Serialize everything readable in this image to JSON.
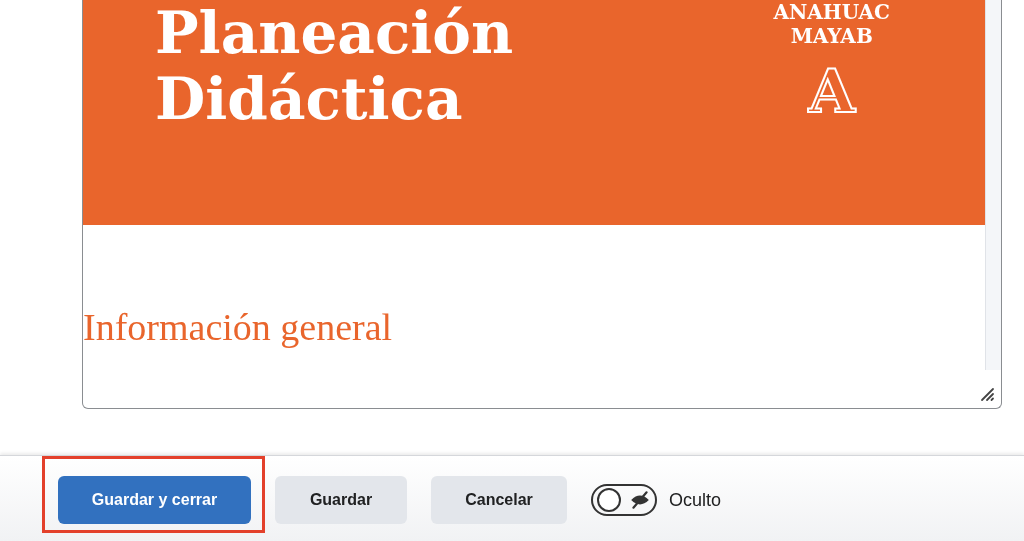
{
  "editor": {
    "banner": {
      "title_lines": [
        "Planeación",
        "Didáctica"
      ],
      "logo_lines": [
        "ANAHUAC",
        "MAYAB"
      ],
      "logo_letter": "A"
    },
    "heading": "Información general"
  },
  "footer": {
    "buttons": [
      {
        "label": "Guardar y cerrar",
        "kind": "primary"
      },
      {
        "label": "Guardar",
        "kind": "secondary"
      },
      {
        "label": "Cancelar",
        "kind": "secondary"
      }
    ],
    "visibility": {
      "on": false,
      "label": "Oculto"
    }
  }
}
